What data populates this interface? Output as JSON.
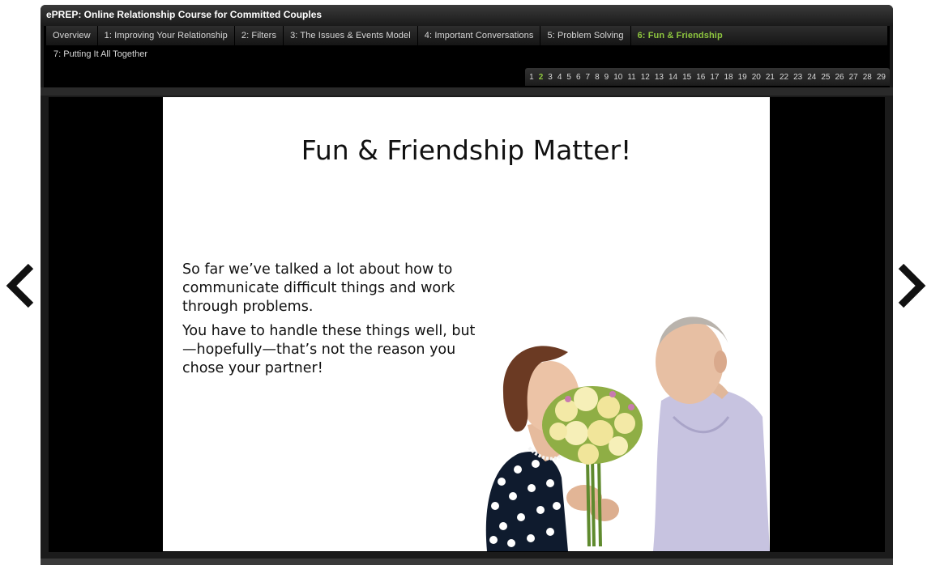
{
  "app": {
    "title": "ePREP: Online Relationship Course for Committed Couples"
  },
  "tabs": [
    {
      "label": "Overview"
    },
    {
      "label": "1: Improving Your Relationship"
    },
    {
      "label": "2: Filters"
    },
    {
      "label": "3: The Issues & Events Model"
    },
    {
      "label": "4: Important Conversations"
    },
    {
      "label": "5: Problem Solving"
    },
    {
      "label": "6: Fun & Friendship",
      "active": true
    }
  ],
  "tab_overflow": {
    "label": "7: Putting It All Together"
  },
  "pages": [
    "1",
    "2",
    "3",
    "4",
    "5",
    "6",
    "7",
    "8",
    "9",
    "10",
    "11",
    "12",
    "13",
    "14",
    "15",
    "16",
    "17",
    "18",
    "19",
    "20",
    "21",
    "22",
    "23",
    "24",
    "25",
    "26",
    "27",
    "28",
    "29"
  ],
  "current_page": "2",
  "slide": {
    "title": "Fun & Friendship Matter!",
    "paragraphs": [
      "So far we’ve talked a lot about how to communicate difficult things and work through problems.",
      "You have to handle these things well, but —hopefully—that’s not the reason you chose your partner!"
    ]
  },
  "colors": {
    "accent": "#8ec63f",
    "frame": "#1b1b1b",
    "stage": "#000000"
  },
  "icons": {
    "prev": "chevron-left-icon",
    "next": "chevron-right-icon"
  }
}
